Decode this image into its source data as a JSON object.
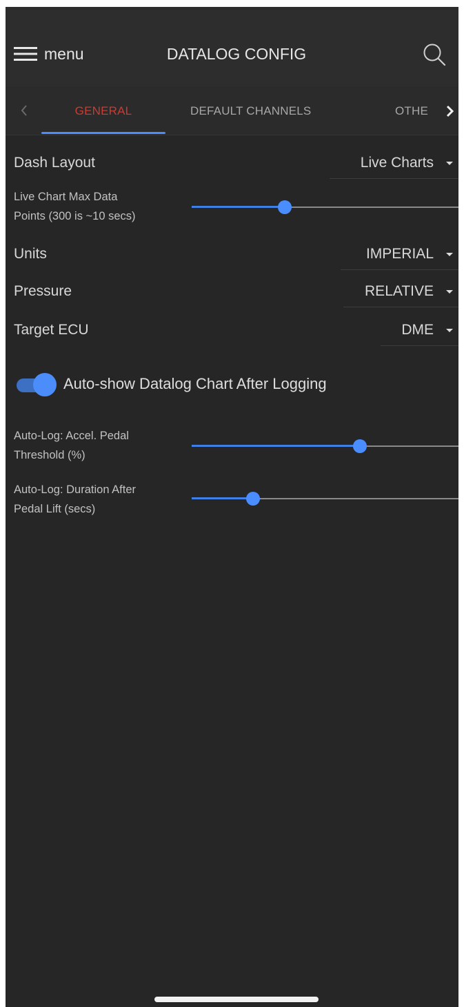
{
  "header": {
    "menu_label": "menu",
    "title": "DATALOG CONFIG",
    "menu_icon": "hamburger-icon",
    "search_icon": "search-icon"
  },
  "tabs": {
    "items": [
      {
        "label": "GENERAL",
        "active": true
      },
      {
        "label": "DEFAULT CHANNELS",
        "active": false
      },
      {
        "label": "OTHE",
        "active": false
      }
    ],
    "prev_icon": "chevron-left-icon",
    "next_icon": "chevron-right-icon"
  },
  "settings": {
    "dash_layout": {
      "label": "Dash Layout",
      "value": "Live Charts"
    },
    "live_chart_max": {
      "label_line1": "Live Chart Max Data",
      "label_line2": "Points (300 is ~10 secs)",
      "level": 0.35
    },
    "units": {
      "label": "Units",
      "value": "IMPERIAL"
    },
    "pressure": {
      "label": "Pressure",
      "value": "RELATIVE"
    },
    "target_ecu": {
      "label": "Target ECU",
      "value": "DME"
    },
    "auto_show": {
      "label": "Auto-show Datalog Chart After Logging",
      "enabled": true
    },
    "accel_pedal": {
      "label_line1": "Auto-Log: Accel. Pedal",
      "label_line2": "Threshold (%)",
      "level": 0.63
    },
    "duration": {
      "label_line1": "Auto-Log: Duration After",
      "label_line2": "Pedal Lift (secs)",
      "level": 0.23
    }
  },
  "colors": {
    "accent": "#4a8dff",
    "active_tab": "#c93c34",
    "background": "#262626"
  }
}
